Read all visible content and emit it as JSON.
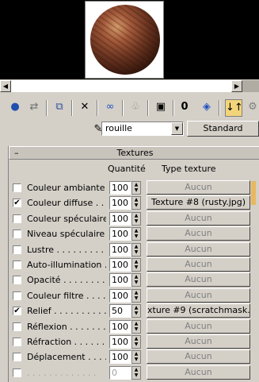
{
  "toolbar": {
    "icons": [
      "get-material-icon",
      "put-to-scene-icon",
      "assign-to-selection-icon",
      "reset-icon",
      "make-copy-icon",
      "make-unique-icon",
      "put-to-library-icon",
      "material-id-channel-icon",
      "show-in-viewport-icon",
      "show-end-result-icon",
      "go-to-parent-icon",
      "go-forward-icon"
    ]
  },
  "material": {
    "name": "rouille",
    "type_button": "Standard"
  },
  "rollout": {
    "toggle": "–",
    "title": "Textures",
    "qty_header": "Quantité",
    "type_header": "Type texture"
  },
  "maps": [
    {
      "label": "Couleur ambiante . .",
      "checked": "",
      "amount": "100",
      "map": "Aucun"
    },
    {
      "label": "Couleur diffuse . . . .",
      "checked": "✔",
      "amount": "100",
      "map": "Texture #8 (rusty.jpg)"
    },
    {
      "label": "Couleur spéculaire . .",
      "checked": "",
      "amount": "100",
      "map": "Aucun"
    },
    {
      "label": "Niveau spéculaire . .",
      "checked": "",
      "amount": "100",
      "map": "Aucun"
    },
    {
      "label": "Lustre . . . . . . . . . .",
      "checked": "",
      "amount": "100",
      "map": "Aucun"
    },
    {
      "label": "Auto-illumination . . .",
      "checked": "",
      "amount": "100",
      "map": "Aucun"
    },
    {
      "label": "Opacité . . . . . . . . .",
      "checked": "",
      "amount": "100",
      "map": "Aucun"
    },
    {
      "label": "Couleur filtre . . . . .",
      "checked": "",
      "amount": "100",
      "map": "Aucun"
    },
    {
      "label": "Relief . . . . . . . . . .",
      "checked": "✔",
      "amount": "50",
      "map": "xture #9 (scratchmask.jpg)"
    },
    {
      "label": "Réflexion . . . . . . . .",
      "checked": "",
      "amount": "100",
      "map": "Aucun"
    },
    {
      "label": "Réfraction . . . . . . .",
      "checked": "",
      "amount": "100",
      "map": "Aucun"
    },
    {
      "label": "Déplacement . . . . .",
      "checked": "",
      "amount": "100",
      "map": "Aucun"
    },
    {
      "label": ". . . . . . . . . . . . .",
      "checked": "",
      "amount": "0",
      "map": "Aucun"
    }
  ]
}
